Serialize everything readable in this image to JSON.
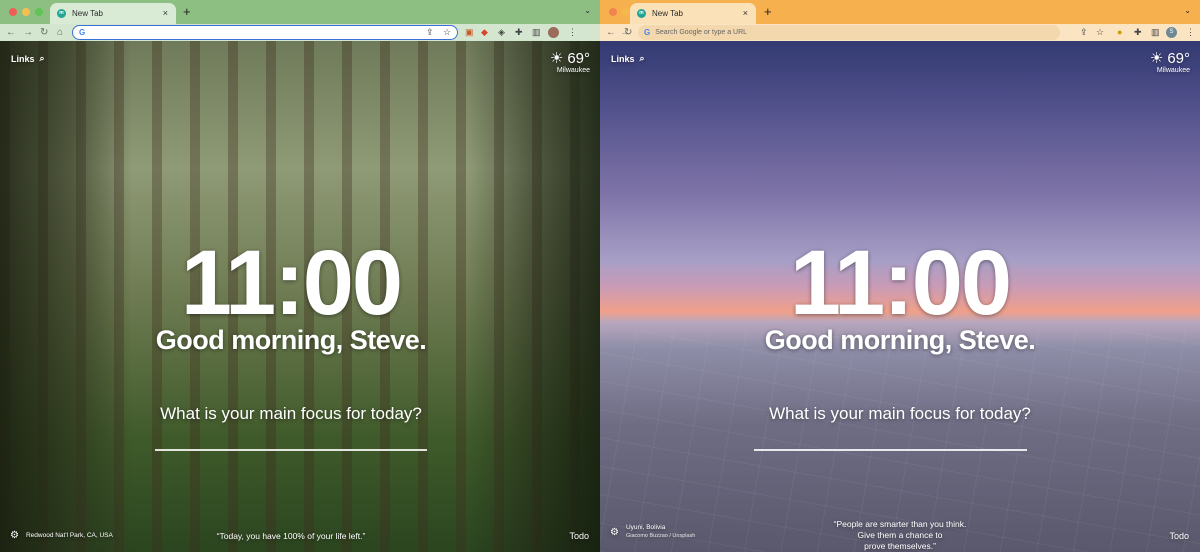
{
  "left": {
    "tab_title": "New Tab",
    "omnibox_text": "G",
    "links_label": "Links",
    "weather": {
      "temp": "69°",
      "location": "Milwaukee"
    },
    "clock": "11:00",
    "greeting": "Good morning, Steve.",
    "focus_question": "What is your main focus for today?",
    "photo_credit": "Redwood Nat'l Park, CA, USA",
    "quote": "“Today, you have 100% of your life left.”",
    "todo_label": "Todo",
    "colors": {
      "tabstrip": "#8dbf82",
      "toolbar": "#d4e6cf"
    }
  },
  "right": {
    "tab_title": "New Tab",
    "omnibox_placeholder": "Search Google or type a URL",
    "links_label": "Links",
    "weather": {
      "temp": "69°",
      "location": "Milwaukee"
    },
    "clock": "11:00",
    "greeting": "Good morning, Steve.",
    "focus_question": "What is your main focus for today?",
    "photo_credit": "Uyuni, Bolivia",
    "photo_credit_sub": "Giacomo Buzzao / Unsplash",
    "quote_lines": [
      "“People are smarter than you think.",
      "Give them a chance to",
      "prove themselves.”"
    ],
    "todo_label": "Todo",
    "profile_initial": "S",
    "colors": {
      "tabstrip": "#f6b04d",
      "toolbar": "#fbe4c2"
    }
  },
  "icons": {
    "back": "←",
    "forward": "→",
    "reload": "↻",
    "home": "⌂",
    "share": "⇪",
    "star": "☆",
    "extensions": "✚",
    "menu": "⋮",
    "sidebar": "▥",
    "search": "⌕",
    "weather": "☀",
    "settings": "⚙",
    "close": "×",
    "new_tab": "+",
    "chevron": "⌄"
  }
}
